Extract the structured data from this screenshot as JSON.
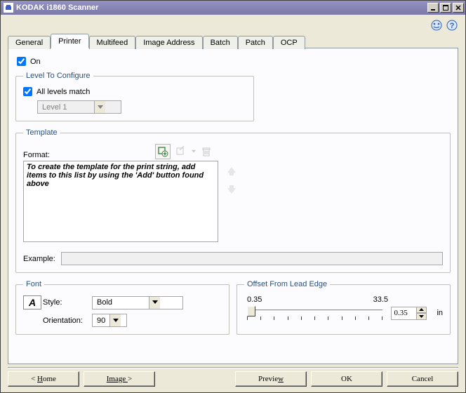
{
  "window": {
    "title": "KODAK i1860 Scanner"
  },
  "tabs": [
    {
      "label": "General"
    },
    {
      "label": "Printer"
    },
    {
      "label": "Multifeed"
    },
    {
      "label": "Image Address"
    },
    {
      "label": "Batch"
    },
    {
      "label": "Patch"
    },
    {
      "label": "OCP"
    }
  ],
  "active_tab_index": 1,
  "printer": {
    "on_label": "On",
    "level_group": "Level To Configure",
    "all_levels_label": "All levels match",
    "level_value": "Level 1",
    "template_group": "Template",
    "format_label": "Format:",
    "format_placeholder": "To create the template for the print string, add items to this list by using the 'Add' button found above",
    "example_label": "Example:",
    "example_value": ""
  },
  "font_group": {
    "title": "Font",
    "style_label": "Style:",
    "style_value": "Bold",
    "orientation_label": "Orientation:",
    "orientation_value": "90",
    "a_glyph": "A"
  },
  "offset_group": {
    "title": "Offset From Lead Edge",
    "min": "0.35",
    "max": "33.5",
    "value": "0.35",
    "unit": "in"
  },
  "buttons": {
    "home_pre": "< ",
    "home_hot": "H",
    "home_post": "ome",
    "image_text": "Image ",
    "image_suffix": ">",
    "preview_pre": "Previe",
    "preview_hot": "w",
    "ok": "OK",
    "cancel": "Cancel"
  }
}
